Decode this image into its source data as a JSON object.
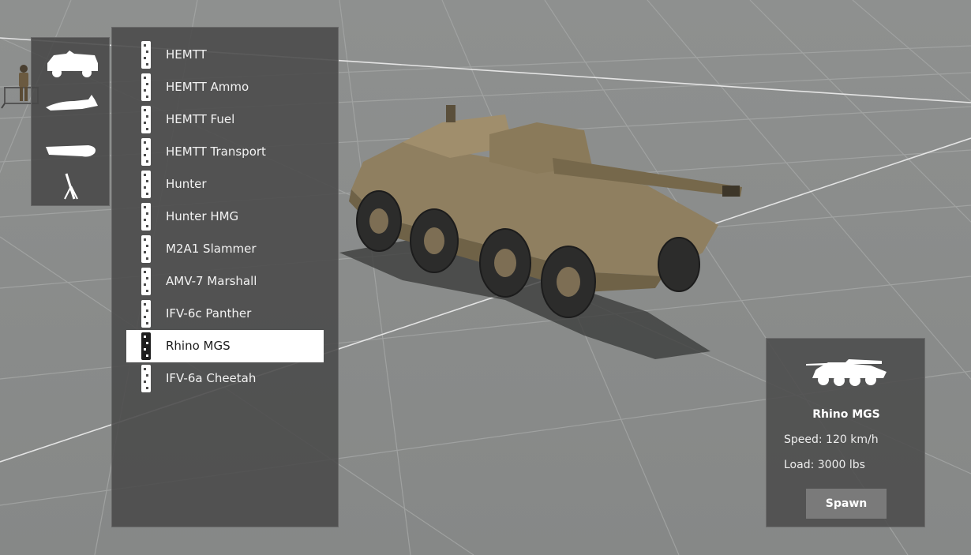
{
  "categories": [
    {
      "icon": "car-icon"
    },
    {
      "icon": "plane-icon"
    },
    {
      "icon": "boat-icon"
    },
    {
      "icon": "mortar-icon"
    }
  ],
  "vehicles": [
    {
      "label": "HEMTT",
      "selected": false
    },
    {
      "label": "HEMTT Ammo",
      "selected": false
    },
    {
      "label": "HEMTT Fuel",
      "selected": false
    },
    {
      "label": "HEMTT Transport",
      "selected": false
    },
    {
      "label": "Hunter",
      "selected": false
    },
    {
      "label": "Hunter HMG",
      "selected": false
    },
    {
      "label": "M2A1 Slammer",
      "selected": false
    },
    {
      "label": "AMV-7 Marshall",
      "selected": false
    },
    {
      "label": "IFV-6c Panther",
      "selected": false
    },
    {
      "label": "Rhino MGS",
      "selected": true
    },
    {
      "label": "IFV-6a Cheetah",
      "selected": false
    }
  ],
  "info": {
    "name": "Rhino MGS",
    "speed": "Speed: 120 km/h",
    "load": "Load: 3000 lbs",
    "spawn_label": "Spawn"
  },
  "colors": {
    "panel": "#4b4b4b",
    "selected_row": "#ffffff",
    "ground": "#8a8c8b",
    "vehicle_tan": "#8a7a5c"
  }
}
